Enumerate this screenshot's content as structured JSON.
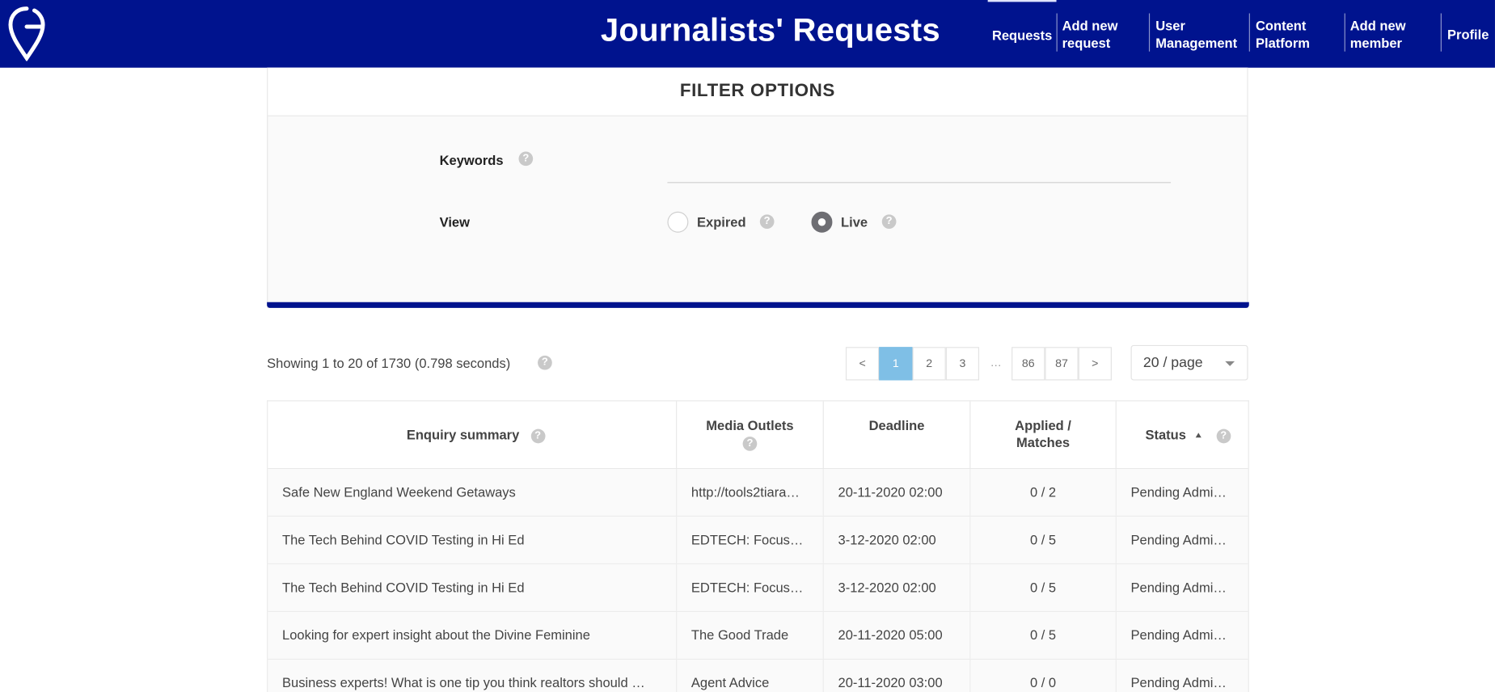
{
  "header": {
    "title": "Journalists' Requests",
    "nav": [
      {
        "label": "Requests",
        "active": true
      },
      {
        "label": "Add new request"
      },
      {
        "label": "User Management"
      },
      {
        "label": "Content Platform"
      },
      {
        "label": "Add new member"
      },
      {
        "label": "Profile"
      }
    ],
    "brand_color": "#00138e"
  },
  "filter": {
    "title": "FILTER OPTIONS",
    "keywords_label": "Keywords",
    "keywords_value": "",
    "view_label": "View",
    "view_options": [
      {
        "label": "Expired",
        "checked": false
      },
      {
        "label": "Live",
        "checked": true
      }
    ]
  },
  "results": {
    "showing": "Showing 1 to 20 of 1730 (0.798 seconds)",
    "pagination": {
      "prev": "<",
      "pages": [
        "1",
        "2",
        "3"
      ],
      "ellipsis": "…",
      "last_pages": [
        "86",
        "87"
      ],
      "next": ">",
      "current": "1"
    },
    "per_page": "20 / page"
  },
  "table": {
    "columns": {
      "summary": "Enquiry summary",
      "outlets": "Media Outlets",
      "deadline": "Deadline",
      "applied_1": "Applied /",
      "applied_2": "Matches",
      "status": "Status"
    },
    "rows": [
      {
        "summary": "Safe New England Weekend Getaways",
        "outlet": "http://tools2tiara…",
        "deadline": "20-11-2020 02:00",
        "applied": "0 / 2",
        "status": "Pending Admi…"
      },
      {
        "summary": "The Tech Behind COVID Testing in Hi Ed",
        "outlet": "EDTECH: Focus…",
        "deadline": "3-12-2020 02:00",
        "applied": "0 / 5",
        "status": "Pending Admi…"
      },
      {
        "summary": "The Tech Behind COVID Testing in Hi Ed",
        "outlet": "EDTECH: Focus…",
        "deadline": "3-12-2020 02:00",
        "applied": "0 / 5",
        "status": "Pending Admi…"
      },
      {
        "summary": "Looking for expert insight about the Divine Feminine",
        "outlet": "The Good Trade",
        "deadline": "20-11-2020 05:00",
        "applied": "0 / 5",
        "status": "Pending Admi…"
      },
      {
        "summary": "Business experts! What is one tip you think realtors should …",
        "outlet": "Agent Advice",
        "deadline": "20-11-2020 03:00",
        "applied": "0 / 0",
        "status": "Pending Admi…"
      }
    ]
  }
}
